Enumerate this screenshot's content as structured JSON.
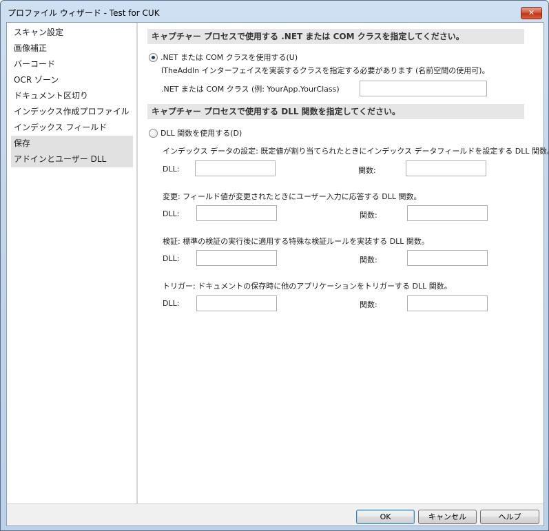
{
  "window": {
    "title": "プロファイル ウィザード - Test for CUK",
    "close_label": "✕"
  },
  "sidebar": {
    "items": [
      {
        "label": "スキャン設定",
        "selected": false
      },
      {
        "label": "画像補正",
        "selected": false
      },
      {
        "label": "バーコード",
        "selected": false
      },
      {
        "label": "OCR ゾーン",
        "selected": false
      },
      {
        "label": "ドキュメント区切り",
        "selected": false
      },
      {
        "label": "インデックス作成プロファイル",
        "selected": false
      },
      {
        "label": "インデックス フィールド",
        "selected": false
      },
      {
        "label": "保存",
        "selected": true
      },
      {
        "label": "アドインとユーザー DLL",
        "selected": true
      }
    ]
  },
  "net_section": {
    "header": "キャプチャー プロセスで使用する .NET または COM クラスを指定してください。",
    "radio_label": ".NET または COM クラスを使用する(U)",
    "radio_checked": true,
    "description": "ITheAddIn インターフェイスを実装するクラスを指定する必要があります (名前空間の使用可)。",
    "class_label": ".NET または COM クラス (例: YourApp.YourClass)",
    "class_value": ""
  },
  "dll_section": {
    "header": "キャプチャー プロセスで使用する DLL 関数を指定してください。",
    "radio_label": "DLL 関数を使用する(D)",
    "radio_checked": false,
    "groups": [
      {
        "description": "インデックス データの設定: 既定値が割り当てられたときにインデックス データフィールドを設定する DLL 関数。",
        "dll_label": "DLL:",
        "dll_value": "",
        "func_label": "関数:",
        "func_value": ""
      },
      {
        "description": "変更: フィールド値が変更されたときにユーザー入力に応答する DLL 関数。",
        "dll_label": "DLL:",
        "dll_value": "",
        "func_label": "関数:",
        "func_value": ""
      },
      {
        "description": "検証: 標準の検証の実行後に適用する特殊な検証ルールを実装する DLL 関数。",
        "dll_label": "DLL:",
        "dll_value": "",
        "func_label": "関数:",
        "func_value": ""
      },
      {
        "description": "トリガー: ドキュメントの保存時に他のアプリケーションをトリガーする DLL 関数。",
        "dll_label": "DLL:",
        "dll_value": "",
        "func_label": "関数:",
        "func_value": ""
      }
    ]
  },
  "buttons": {
    "ok": "OK",
    "cancel": "キャンセル",
    "help": "ヘルプ"
  }
}
